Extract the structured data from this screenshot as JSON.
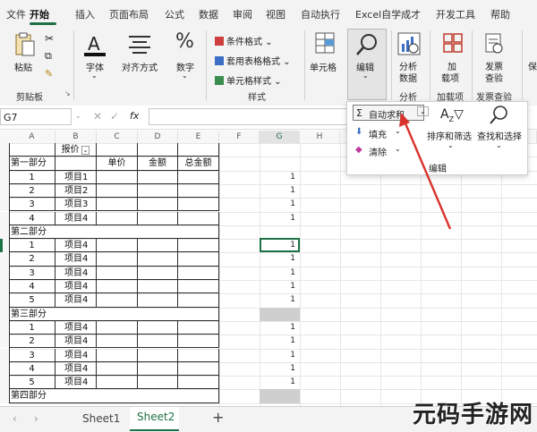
{
  "menu": {
    "tabs": [
      "文件",
      "开始",
      "插入",
      "页面布局",
      "公式",
      "数据",
      "审阅",
      "视图",
      "自动执行",
      "Excel自学成才",
      "开发工具",
      "帮助"
    ],
    "active": "开始"
  },
  "ribbon": {
    "paste": "粘贴",
    "clipboard_group": "剪贴板",
    "font": "字体",
    "alignment": "对齐方式",
    "number": "数字",
    "conditional_format": "条件格式",
    "table_format": "套用表格格式",
    "cell_style": "单元格样式",
    "styles_group": "样式",
    "cells": "单元格",
    "editing": "编辑",
    "analyze_data": [
      "分析",
      "数据"
    ],
    "analysis_group": "分析",
    "addins": [
      "加",
      "载项"
    ],
    "addins_group": "加载项",
    "invoice_check": [
      "发票",
      "查验"
    ],
    "invoice_group": "发票查验",
    "save_partial": "保"
  },
  "formula_bar": {
    "name_box": "G7",
    "fx": "fx",
    "cancel": "✕",
    "confirm": "✓"
  },
  "grid": {
    "columns": [
      "A",
      "B",
      "C",
      "D",
      "E",
      "F",
      "G",
      "H"
    ],
    "header_row": {
      "b": "报价",
      "c": "单价",
      "d": "金额",
      "e": "总金额"
    },
    "rows": [
      {
        "a": "第一部分",
        "b": "",
        "g": ""
      },
      {
        "a": "1",
        "b": "项目1",
        "g": "1"
      },
      {
        "a": "2",
        "b": "项目2",
        "g": "1"
      },
      {
        "a": "3",
        "b": "项目3",
        "g": "1"
      },
      {
        "a": "4",
        "b": "项目4",
        "g": "1"
      },
      {
        "a": "第二部分",
        "b": "",
        "g": ""
      },
      {
        "a": "1",
        "b": "项目4",
        "g": "1"
      },
      {
        "a": "2",
        "b": "项目4",
        "g": "1"
      },
      {
        "a": "3",
        "b": "项目4",
        "g": "1"
      },
      {
        "a": "4",
        "b": "项目4",
        "g": "1"
      },
      {
        "a": "5",
        "b": "项目4",
        "g": "1"
      },
      {
        "a": "第三部分",
        "b": "",
        "g": ""
      },
      {
        "a": "1",
        "b": "项目4",
        "g": "1"
      },
      {
        "a": "2",
        "b": "项目4",
        "g": "1"
      },
      {
        "a": "3",
        "b": "项目4",
        "g": "1"
      },
      {
        "a": "4",
        "b": "项目4",
        "g": "1"
      },
      {
        "a": "5",
        "b": "项目4",
        "g": "1"
      },
      {
        "a": "第四部分",
        "b": "",
        "g": ""
      }
    ]
  },
  "popup": {
    "autosum": "自动求和",
    "fill": "填充",
    "clear": "清除",
    "sort_filter": "排序和筛选",
    "find_select": "查找和选择",
    "group_label": "编辑"
  },
  "sheets": [
    "Sheet1",
    "Sheet2"
  ],
  "add_sheet": "+",
  "watermark": "元码手游网",
  "colors": {
    "accent": "#1e7145",
    "arrow": "#d9322b"
  }
}
